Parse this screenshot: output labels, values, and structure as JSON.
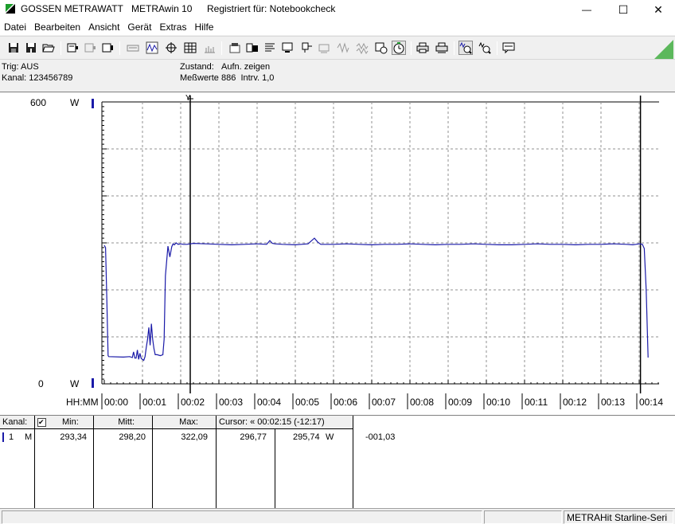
{
  "window": {
    "company": "GOSSEN METRAWATT",
    "app": "METRAwin 10",
    "registered": "Registriert für: Notebookcheck",
    "minimize": "—",
    "maximize": "☐",
    "close": "✕"
  },
  "menu": [
    "Datei",
    "Bearbeiten",
    "Ansicht",
    "Gerät",
    "Extras",
    "Hilfe"
  ],
  "info": {
    "trig": "Trig: AUS",
    "kanal": "Kanal:  123456789",
    "zustand_label": "Zustand:",
    "zustand_value": "Aufn. zeigen",
    "messwerte": "Meßwerte 886",
    "intrv": "Intrv. 1,0"
  },
  "chart_data": {
    "type": "line",
    "y_top_label": "600",
    "y_bottom_label": "0",
    "y_unit": "W",
    "ylim": [
      0,
      600
    ],
    "x_axis_label": "HH:MM",
    "x_ticks": [
      "00:00",
      "00:01",
      "00:02",
      "00:03",
      "00:04",
      "00:05",
      "00:06",
      "00:07",
      "00:08",
      "00:09",
      "00:10",
      "00:11",
      "00:12",
      "00:13",
      "00:14"
    ],
    "grid": true,
    "series": [
      {
        "color": "#1a1aa8",
        "x": [
          0,
          2,
          4,
          6,
          7,
          30,
          40,
          44,
          46,
          48,
          50,
          52,
          54,
          56,
          58,
          62,
          64,
          66,
          68,
          70,
          72,
          74,
          76,
          78,
          80,
          83,
          88,
          92,
          94,
          96,
          100,
          103,
          106,
          108,
          110,
          113,
          116,
          120,
          124,
          130,
          140,
          160,
          180,
          200,
          220,
          240,
          255,
          260,
          264,
          268,
          280,
          300,
          320,
          330,
          335,
          340,
          360,
          380,
          400,
          420,
          440,
          460,
          480,
          500,
          520,
          540,
          560,
          580,
          600,
          620,
          640,
          660,
          680,
          700,
          720,
          740,
          760,
          780,
          800,
          820,
          830,
          835,
          840,
          845,
          848,
          851,
          854
        ],
        "y": [
          295,
          290,
          180,
          60,
          58,
          57,
          58,
          56,
          68,
          55,
          55,
          72,
          52,
          65,
          54,
          50,
          58,
          78,
          95,
          120,
          82,
          128,
          95,
          75,
          62,
          62,
          60,
          62,
          95,
          230,
          293,
          270,
          292,
          298,
          296,
          300,
          297,
          298,
          297,
          297,
          299,
          298,
          297,
          296,
          297,
          298,
          297,
          305,
          299,
          298,
          297,
          296,
          298,
          310,
          302,
          297,
          297,
          298,
          297,
          296,
          297,
          297,
          298,
          297,
          296,
          297,
          297,
          298,
          297,
          296,
          296,
          297,
          298,
          297,
          297,
          296,
          297,
          297,
          298,
          297,
          296,
          297,
          298,
          297,
          288,
          200,
          56
        ]
      }
    ],
    "cursor_marker": "Y"
  },
  "table": {
    "headers": {
      "kanal": "Kanal:",
      "check": "✔",
      "min": "Min:",
      "mitt": "Mitt:",
      "max": "Max:",
      "cursor": "Cursor: « 00:02:15 (-12:17)"
    },
    "row": {
      "kanal": "1",
      "mode": "M",
      "min": "293,34",
      "mitt": "298,20",
      "max": "322,09",
      "cursor_a": "296,77",
      "cursor_b": "295,74",
      "unit": "W",
      "delta": "-001,03"
    }
  },
  "status": {
    "device": "METRAHit Starline-Seri"
  }
}
